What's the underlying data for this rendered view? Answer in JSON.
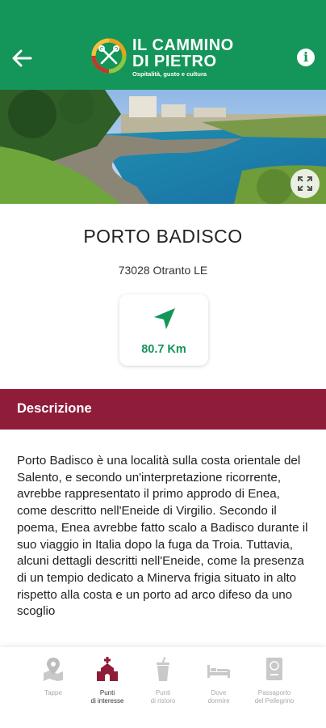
{
  "header": {
    "logo_line1": "IL CAMMINO",
    "logo_line2": "DI PIETRO",
    "logo_tagline": "Ospitalità, gusto e cultura",
    "back_icon": "arrow-left-icon",
    "info_glyph": "i"
  },
  "place": {
    "name": "PORTO BADISCO",
    "address": "73028 Otranto LE",
    "distance": "80.7 Km"
  },
  "description": {
    "section_label": "Descrizione",
    "text": "Porto Badisco è una località sulla costa orientale del Salento, e secondo un'interpretazione ricorrente, avrebbe rappresentato il primo approdo di Enea, come descritto nell'Eneide di Virgilio. Secondo il poema, Enea avrebbe fatto scalo a Badisco durante il suo viaggio in Italia dopo la fuga da Troia. Tuttavia, alcuni dettagli descritti nell'Eneide, come la presenza di un tempio dedicato a Minerva frigia situato in alto rispetto alla costa e un porto ad arco difeso da uno scoglio"
  },
  "nav": {
    "items": [
      {
        "line1": "Tappe",
        "line2": "",
        "icon": "map-pin-icon",
        "active": false
      },
      {
        "line1": "Punti",
        "line2": "di interesse",
        "icon": "church-icon",
        "active": true
      },
      {
        "line1": "Punti",
        "line2": "di ristoro",
        "icon": "drink-cup-icon",
        "active": false
      },
      {
        "line1": "Dove",
        "line2": "dormire",
        "icon": "bed-icon",
        "active": false
      },
      {
        "line1": "Passaporto",
        "line2": "del Pellegrino",
        "icon": "passport-icon",
        "active": false
      }
    ]
  },
  "colors": {
    "header": "#14955a",
    "section_bar": "#8f1d3a",
    "accent_text": "#14955a",
    "nav_active": "#8f1d3a",
    "nav_inactive": "#bdbdbd"
  }
}
